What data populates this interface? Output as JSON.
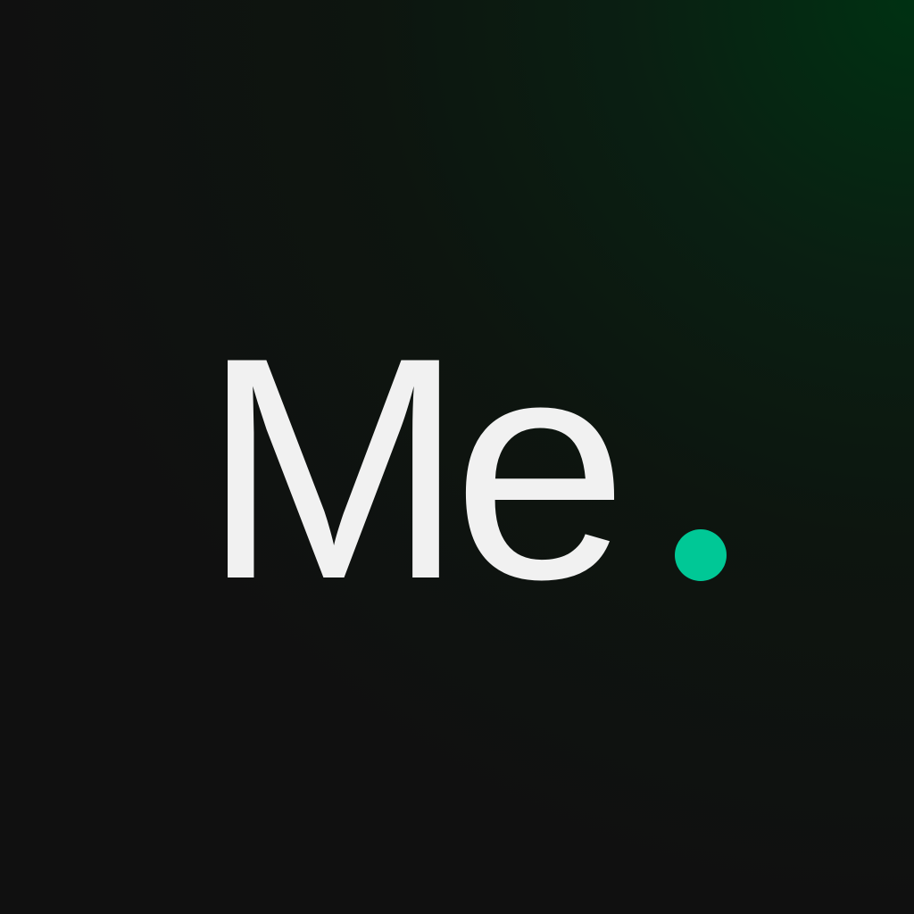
{
  "logo": {
    "text": "Me",
    "text_color": "#f1f1f1",
    "dot_color": "#00c896"
  },
  "background": {
    "base_color": "#101010",
    "glow_color": "#003112"
  }
}
